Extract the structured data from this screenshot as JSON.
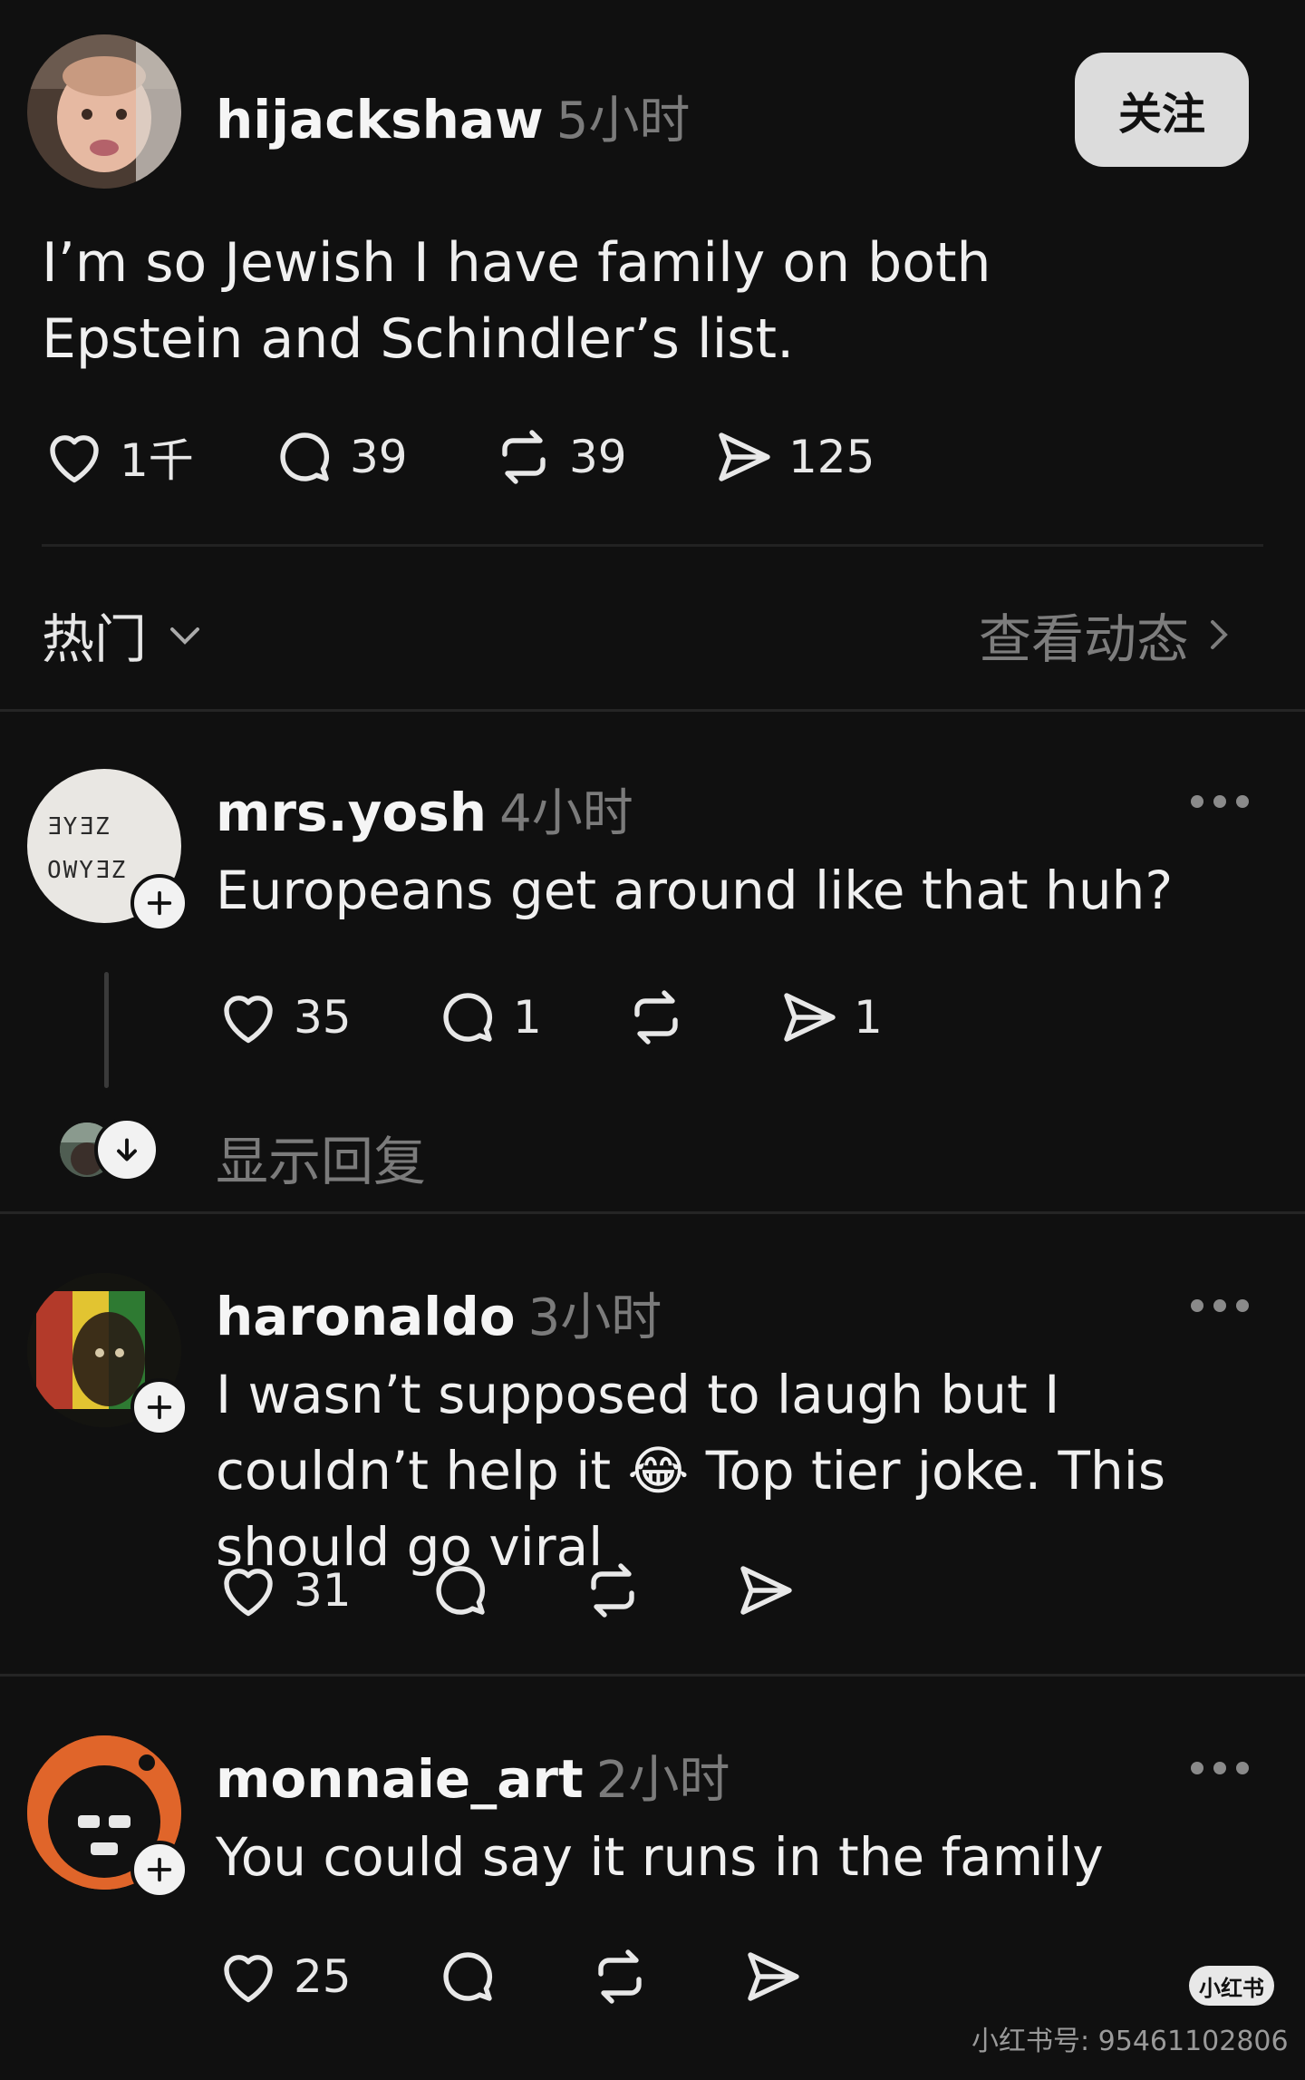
{
  "post": {
    "username": "hijackshaw",
    "time": "5小时",
    "follow_label": "关注",
    "text": "I’m so Jewish I have family on both Epstein and Schindler’s list.",
    "likes": "1千",
    "comments": "39",
    "reposts": "39",
    "shares": "125"
  },
  "sort": {
    "label": "热门",
    "view_activity": "查看动态"
  },
  "comments": [
    {
      "username": "mrs.yosh",
      "time": "4小时",
      "text": "Europeans get around like that huh?",
      "likes": "35",
      "replies": "1",
      "shares": "1",
      "show_replies": "显示回复",
      "avatar_text": "ƎYƎZ OWYƎZ"
    },
    {
      "username": "haronaldo",
      "time": "3小时",
      "text": "I wasn’t supposed to laugh but I couldn’t help it 😂 Top tier joke. This should go viral",
      "likes": "31"
    },
    {
      "username": "monnaie_art",
      "time": "2小时",
      "text": "You could say it runs in the family",
      "likes": "25"
    }
  ],
  "watermark": {
    "logo": "小红书",
    "id": "小红书号: 95461102806"
  },
  "colors": {
    "background": "#101010",
    "text": "#f3f3f3",
    "muted": "#7b7b7b",
    "follow_button": "#dcdcdc"
  }
}
